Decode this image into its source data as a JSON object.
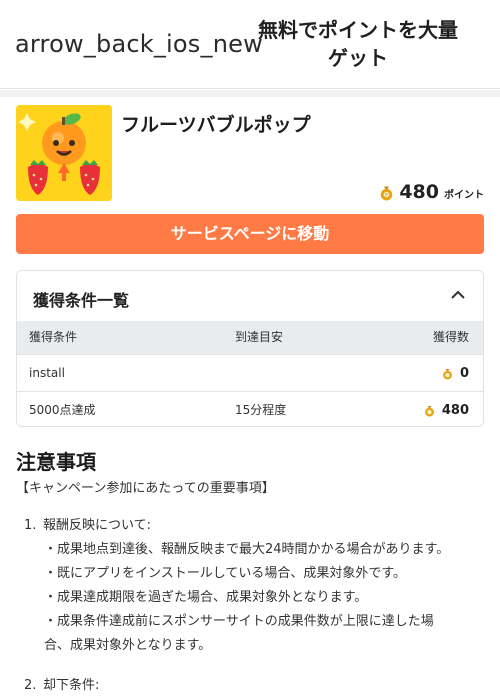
{
  "header": {
    "back_icon_text": "arrow_back_ios_new",
    "title": "無料でポイントを大量ゲット"
  },
  "app": {
    "name": "フルーツバブルポップ",
    "icon": "fruit-bubble-pop-app-icon",
    "points": "480",
    "points_unit": "ポイント"
  },
  "cta": {
    "label": "サービスページに移動"
  },
  "conditions": {
    "title": "獲得条件一覧",
    "columns": [
      "獲得条件",
      "到達目安",
      "獲得数"
    ],
    "rows": [
      {
        "condition": "install",
        "estimate": "",
        "reward": "0"
      },
      {
        "condition": "5000点達成",
        "estimate": "15分程度",
        "reward": "480"
      }
    ]
  },
  "notes": {
    "title": "注意事項",
    "subtitle": "【キャンペーン参加にあたっての重要事項】",
    "items": [
      {
        "num": "1.",
        "title": "報酬反映について:",
        "bullets": [
          "・成果地点到達後、報酬反映まで最大24時間かかる場合があります。",
          "・既にアプリをインストールしている場合、成果対象外です。",
          "・成果達成期限を過ぎた場合、成果対象外となります。",
          "・成果条件達成前にスポンサーサイトの成果件数が上限に達した場",
          "合、成果対象外となります。"
        ]
      },
      {
        "num": "2.",
        "title": "却下条件:"
      }
    ]
  },
  "colors": {
    "accent": "#ff7a45",
    "icon_bg": "#ffd21c",
    "coin": "#e8a317"
  }
}
